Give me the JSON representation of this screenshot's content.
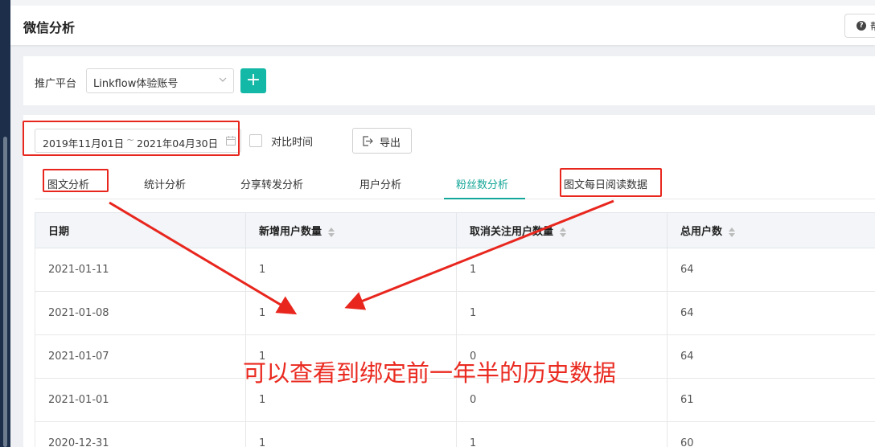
{
  "header": {
    "title": "微信分析",
    "help_label": "帮"
  },
  "filter": {
    "label": "推广平台",
    "platform_value": "Linkflow体验账号",
    "add_label": "+"
  },
  "toolbar": {
    "date_start": "2019年11月01日",
    "date_separator": "~",
    "date_end": "2021年04月30日",
    "compare_label": "对比时间",
    "export_label": "导出"
  },
  "tabs": [
    {
      "label": "图文分析"
    },
    {
      "label": "统计分析"
    },
    {
      "label": "分享转发分析"
    },
    {
      "label": "用户分析"
    },
    {
      "label": "粉丝数分析",
      "active": true
    },
    {
      "label": "图文每日阅读数据"
    }
  ],
  "table": {
    "columns": [
      "日期",
      "新增用户数量",
      "取消关注用户数量",
      "总用户数"
    ],
    "rows": [
      [
        "2021-01-11",
        "1",
        "1",
        "64"
      ],
      [
        "2021-01-08",
        "1",
        "1",
        "64"
      ],
      [
        "2021-01-07",
        "1",
        "0",
        "64"
      ],
      [
        "2021-01-01",
        "1",
        "0",
        "61"
      ],
      [
        "2020-12-31",
        "1",
        "1",
        "60"
      ]
    ]
  },
  "annotation": {
    "text": "可以查看到绑定前一年半的历史数据",
    "color": "#ea2a20"
  },
  "colors": {
    "accent": "#14b8a6",
    "annotation_red": "#e8261e",
    "sidebar": "#1c2e4a"
  }
}
